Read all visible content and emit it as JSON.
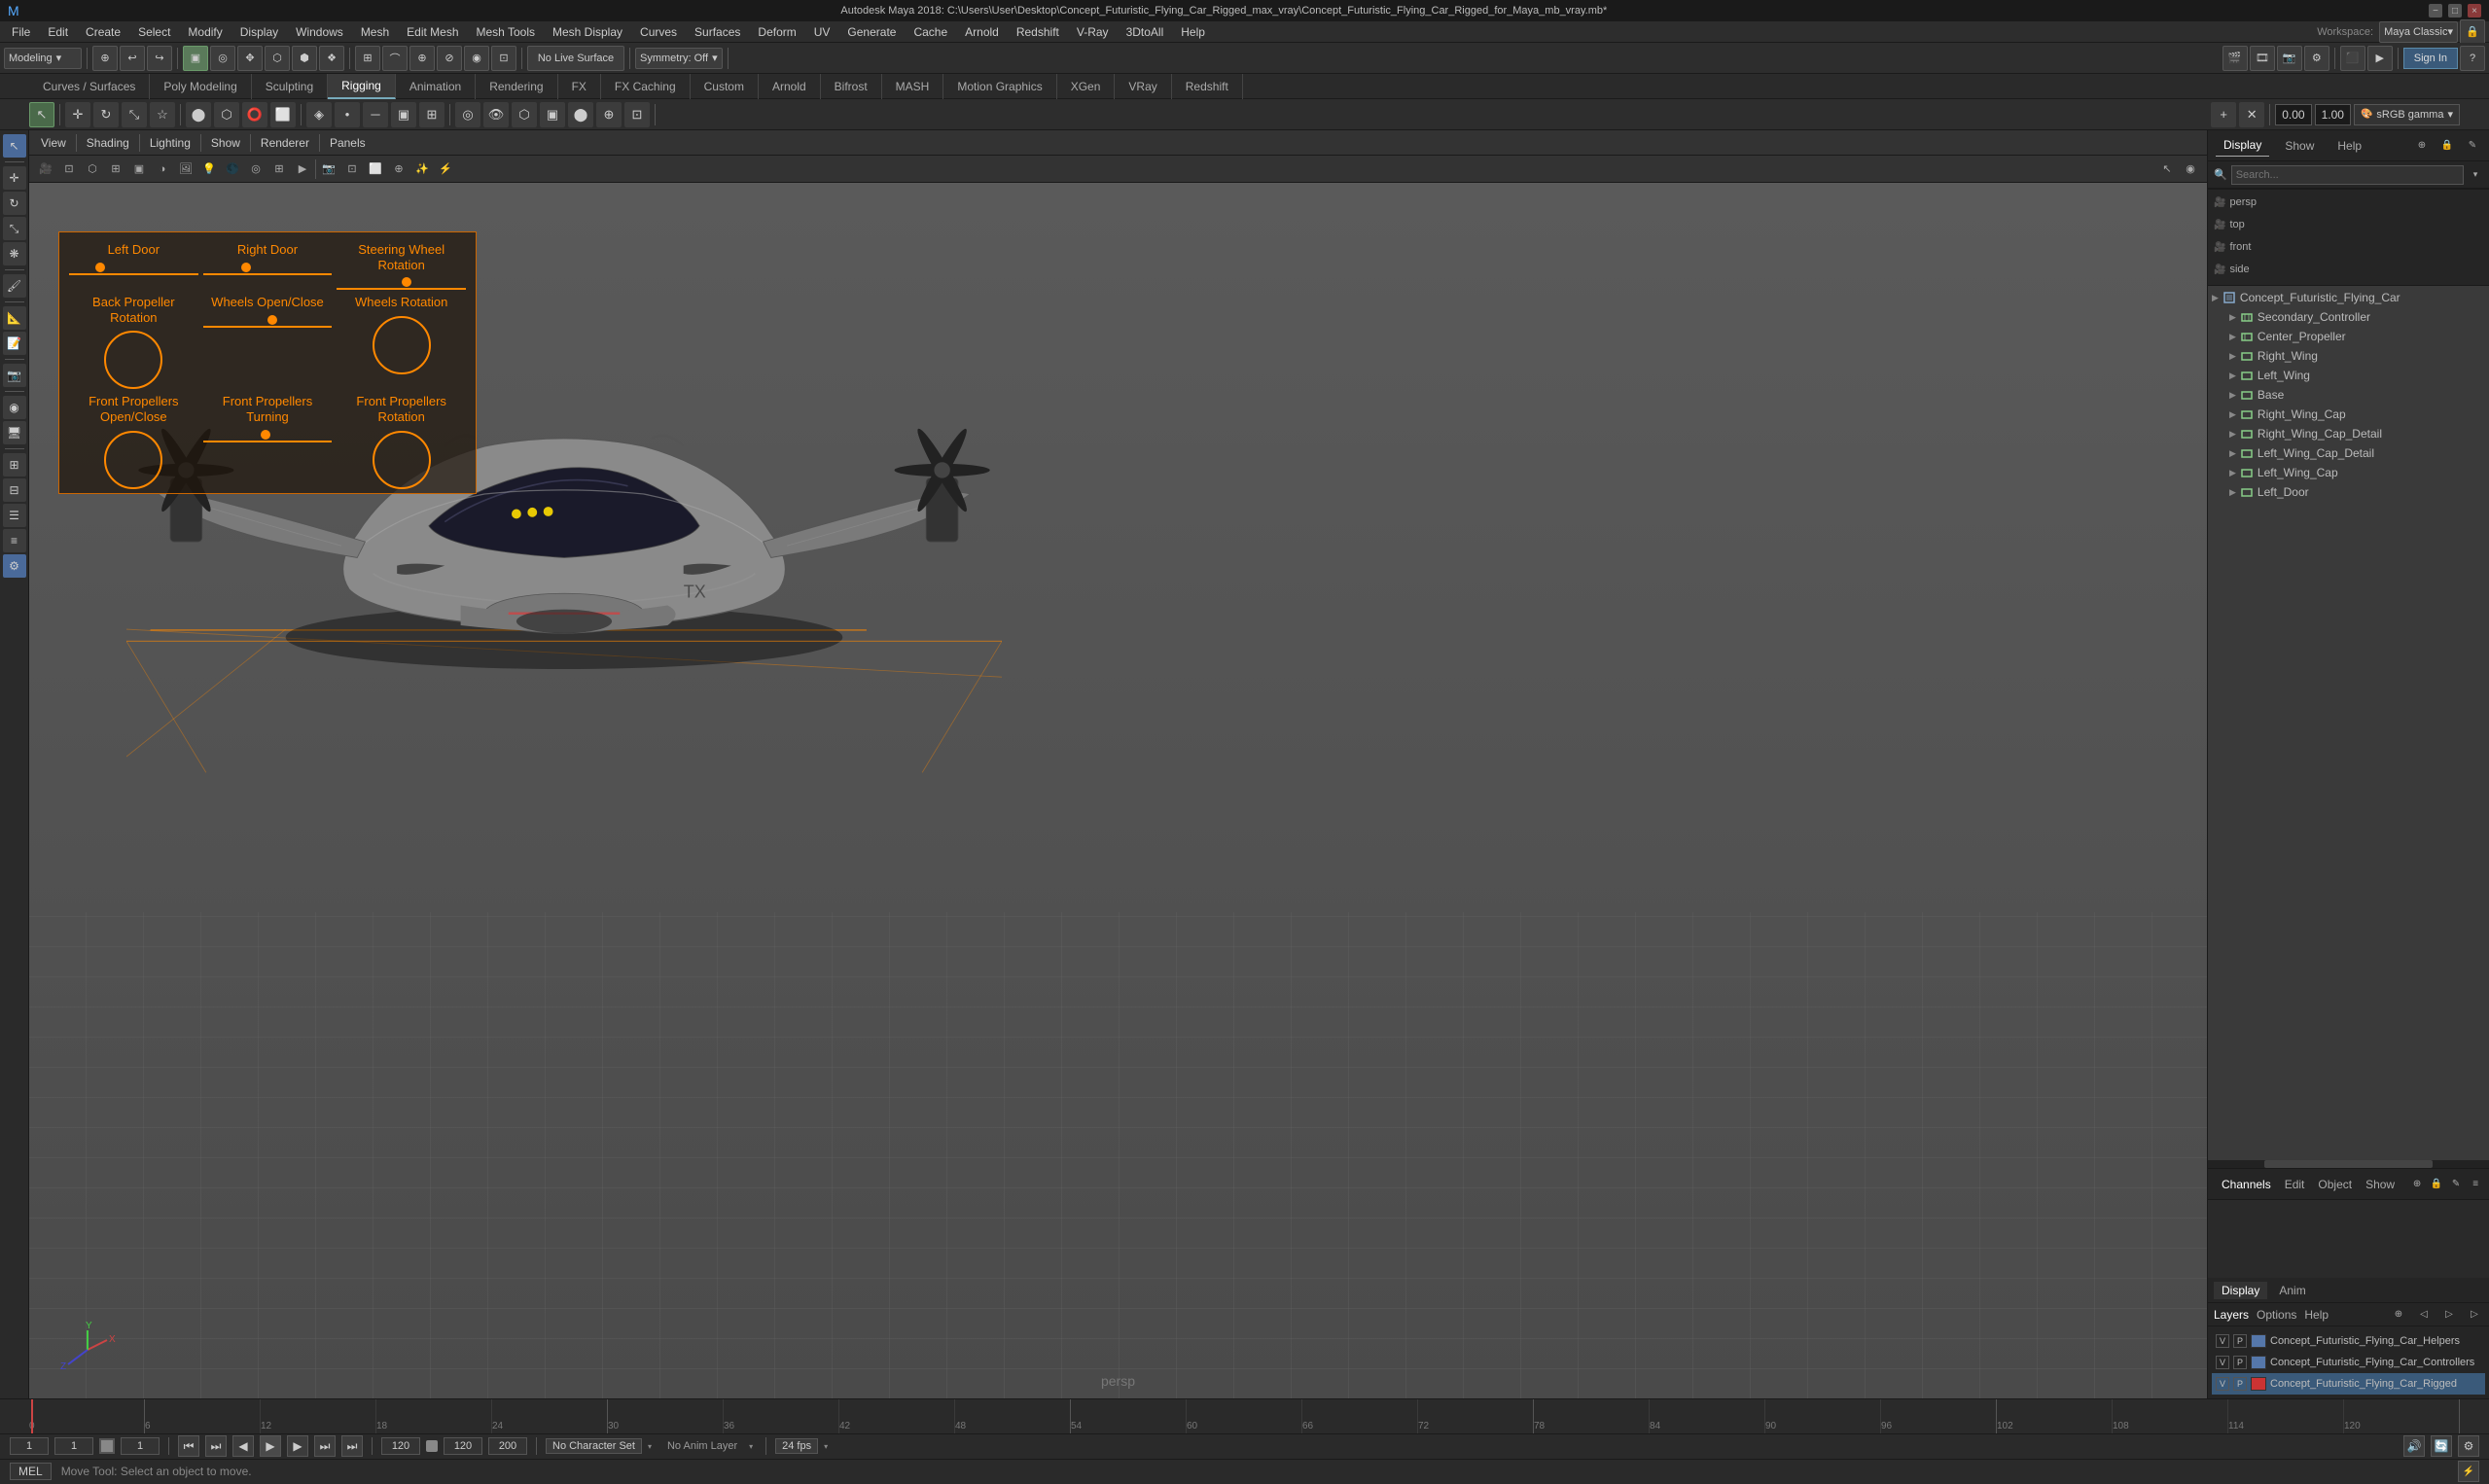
{
  "window": {
    "title": "Autodesk Maya 2018: C:\\Users\\User\\Desktop\\Concept_Futuristic_Flying_Car_Rigged_max_vray\\Concept_Futuristic_Flying_Car_Rigged_for_Maya_mb_vray.mb*",
    "controls": [
      "_",
      "□",
      "×"
    ]
  },
  "menubar": {
    "items": [
      "File",
      "Edit",
      "Create",
      "Select",
      "Modify",
      "Display",
      "Windows",
      "Mesh",
      "Edit Mesh",
      "Mesh Tools",
      "Mesh Display",
      "Curves",
      "Surfaces",
      "Deform",
      "UV",
      "Generate",
      "Cache",
      "Arnold",
      "Redshift",
      "V-Ray",
      "3DtoAll",
      "Help"
    ]
  },
  "toolbar1": {
    "modeling_label": "Modeling",
    "workspace_label": "Maya Classic▾",
    "workspace_prefix": "Workspace:",
    "no_live_surface": "No Live Surface",
    "symmetry": "Symmetry: Off",
    "sign_in": "Sign In"
  },
  "tabs": {
    "items": [
      "Curves / Surfaces",
      "Poly Modeling",
      "Sculpting",
      "Rigging",
      "Animation",
      "Rendering",
      "FX",
      "FX Caching",
      "Custom",
      "Arnold",
      "Bifrost",
      "MASH",
      "Motion Graphics",
      "XGen",
      "VRay",
      "Redshift"
    ],
    "active": "Rigging"
  },
  "viewport": {
    "menus": [
      "View",
      "Shading",
      "Lighting",
      "Show",
      "Renderer",
      "Panels"
    ],
    "persp_label": "persp",
    "gamma_value": "1.00",
    "exposure_value": "0.00",
    "gamma_label": "sRGB gamma"
  },
  "control_panel": {
    "title": "",
    "controls": [
      {
        "label": "Left Door",
        "type": "slider",
        "thumb_pos": "20%"
      },
      {
        "label": "Right Door",
        "type": "slider",
        "thumb_pos": "30%"
      },
      {
        "label": "Steering Wheel Rotation",
        "type": "slider",
        "thumb_pos": "50%"
      },
      {
        "label": "Back Propeller Rotation",
        "type": "circle"
      },
      {
        "label": "Wheels Open/Close",
        "type": "slider",
        "thumb_pos": "50%"
      },
      {
        "label": "Wheels Rotation",
        "type": "circle"
      },
      {
        "label": "Front Propellers Open/Close",
        "type": "circle"
      },
      {
        "label": "Front Propellers Turning",
        "type": "slider",
        "thumb_pos": "45%"
      },
      {
        "label": "Front Propellers Rotation",
        "type": "circle"
      }
    ]
  },
  "outliner": {
    "search_placeholder": "Search...",
    "items": [
      {
        "label": "persp",
        "type": "camera",
        "indent": 0
      },
      {
        "label": "top",
        "type": "camera",
        "indent": 0
      },
      {
        "label": "front",
        "type": "camera",
        "indent": 0
      },
      {
        "label": "side",
        "type": "camera",
        "indent": 0
      },
      {
        "label": "Concept_Futuristic_Flying_Car",
        "type": "group",
        "indent": 0,
        "expanded": true
      },
      {
        "label": "Secondary_Controller",
        "type": "mesh",
        "indent": 1
      },
      {
        "label": "Center_Propeller",
        "type": "mesh",
        "indent": 1
      },
      {
        "label": "Right_Wing",
        "type": "mesh",
        "indent": 1
      },
      {
        "label": "Left_Wing",
        "type": "mesh",
        "indent": 1
      },
      {
        "label": "Base",
        "type": "mesh",
        "indent": 1
      },
      {
        "label": "Right_Wing_Cap",
        "type": "mesh",
        "indent": 1
      },
      {
        "label": "Right_Wing_Cap_Detail",
        "type": "mesh",
        "indent": 1
      },
      {
        "label": "Left_Wing_Cap_Detail",
        "type": "mesh",
        "indent": 1
      },
      {
        "label": "Left_Wing_Cap",
        "type": "mesh",
        "indent": 1
      },
      {
        "label": "Left_Door",
        "type": "mesh",
        "indent": 1
      }
    ]
  },
  "channels": {
    "tabs": [
      "Channels",
      "Edit",
      "Object",
      "Show"
    ]
  },
  "display_anim": {
    "tabs": [
      "Display",
      "Anim"
    ],
    "sub_tabs": [
      "Layers",
      "Options",
      "Help"
    ],
    "active_tab": "Display",
    "active_sub": "Layers"
  },
  "layers": [
    {
      "v": "V",
      "p": "P",
      "color": "#5577aa",
      "name": "Concept_Futuristic_Flying_Car_Helpers"
    },
    {
      "v": "V",
      "p": "P",
      "color": "#5577aa",
      "name": "Concept_Futuristic_Flying_Car_Controllers"
    },
    {
      "v": "V",
      "p": "P",
      "color": "#cc3333",
      "name": "Concept_Futuristic_Flying_Car_Rigged",
      "selected": true
    }
  ],
  "timeline": {
    "start": 0,
    "end": 120,
    "current": 1,
    "ticks": [
      "0",
      "6",
      "12",
      "18",
      "24",
      "30",
      "36",
      "42",
      "48",
      "54",
      "60",
      "66",
      "72",
      "78",
      "84",
      "90",
      "96",
      "102",
      "108",
      "114",
      "120+"
    ]
  },
  "frame_controls": {
    "frame_start": "1",
    "frame_current": "1",
    "frame_range_start": "1",
    "frame_range_end": "120",
    "playback_end": "120",
    "playback_start": "200",
    "fps": "24 fps",
    "no_character_set": "No Character Set",
    "no_anim_layer": "No Anim Layer",
    "transport": [
      "⏮",
      "⏭",
      "⏮",
      "⏴",
      "▶",
      "⏵",
      "⏭",
      "⏭"
    ]
  },
  "mel_bar": {
    "type_label": "MEL",
    "help_text": "Move Tool: Select an object to move."
  },
  "camera_views": {
    "top_label": "top",
    "front_label": "front"
  },
  "right_panel_tabs": {
    "display_label": "Display",
    "show_label": "Show",
    "help_label": "Help"
  }
}
